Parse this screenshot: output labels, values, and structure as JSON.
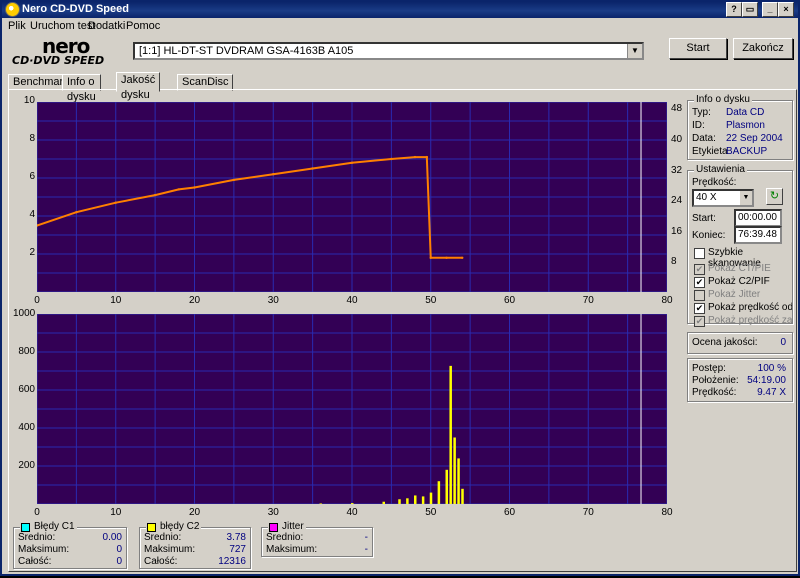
{
  "window": {
    "title": "Nero CD-DVD Speed"
  },
  "menu": [
    "Plik",
    "Uruchom test",
    "Dodatki",
    "Pomoc"
  ],
  "logo": {
    "top": "nero",
    "bottom": "CD·DVD SPEED"
  },
  "drive": {
    "selected": "[1:1]  HL-DT-ST DVDRAM GSA-4163B A105"
  },
  "buttons": {
    "start": "Start",
    "close": "Zakończ"
  },
  "tabs": [
    "Benchmark",
    "Info o dysku",
    "Jakość dysku",
    "ScanDisc"
  ],
  "disc_info": {
    "title": "Info o dysku",
    "type_label": "Typ:",
    "type": "Data CD",
    "id_label": "ID:",
    "id": "Plasmon",
    "date_label": "Data:",
    "date": "22 Sep 2004",
    "label_label": "Etykieta",
    "label": "BACKUP"
  },
  "settings": {
    "title": "Ustawienia",
    "speed_label": "Prędkość:",
    "speed": "40 X",
    "start_label": "Start:",
    "start": "00:00.00",
    "end_label": "Koniec:",
    "end": "76:39.48",
    "quick_scan": "Szybkie skanowanie",
    "opt_ctpie": "Pokaż CT/PIE",
    "opt_c2pif": "Pokaż C2/PIF",
    "opt_jitter": "Pokaż Jitter",
    "opt_read": "Pokaż prędkość odczytu",
    "opt_write": "Pokaż prędkość zapisu"
  },
  "quality": {
    "label": "Ocena jakości:",
    "value": "0"
  },
  "progress": {
    "progress_label": "Postęp:",
    "progress": "100 %",
    "position_label": "Położenie:",
    "position": "54:19.00",
    "speed_label": "Prędkość:",
    "speed": "9.47 X"
  },
  "stats": {
    "c1": {
      "title": "Błędy C1",
      "avg_label": "Średnio:",
      "avg": "0.00",
      "max_label": "Maksimum:",
      "max": "0",
      "total_label": "Całość:",
      "total": "0",
      "color": "#00ffff"
    },
    "c2": {
      "title": "błędy C2",
      "avg_label": "Średnio:",
      "avg": "3.78",
      "max_label": "Maksimum:",
      "max": "727",
      "total_label": "Całość:",
      "total": "12316",
      "color": "#ffff00"
    },
    "jitter": {
      "title": "Jitter",
      "avg_label": "Średnio:",
      "avg": "-",
      "max_label": "Maksimum:",
      "max": "-",
      "color": "#ff00ff"
    }
  },
  "chart_data": [
    {
      "type": "line",
      "name": "read-speed",
      "x_ticks": [
        "0",
        "10",
        "20",
        "30",
        "40",
        "50",
        "60",
        "70",
        "80"
      ],
      "y_ticks_left": [
        "10",
        "8",
        "6",
        "4",
        "2"
      ],
      "y_ticks_right": [
        "48",
        "40",
        "32",
        "24",
        "16",
        "8"
      ],
      "xlim": [
        0,
        80
      ],
      "ylim": [
        0,
        10
      ],
      "ylim_right": [
        0,
        48
      ],
      "series": [
        {
          "color": "#ff8000",
          "x": [
            0,
            5,
            10,
            15,
            18,
            20,
            25,
            30,
            35,
            40,
            45,
            48,
            49.5,
            50,
            52,
            54
          ],
          "y": [
            3.5,
            4.2,
            4.7,
            5.1,
            5.4,
            5.5,
            5.9,
            6.2,
            6.5,
            6.8,
            7.0,
            7.1,
            7.1,
            1.8,
            1.8,
            1.8
          ]
        }
      ],
      "marker_x": 76.7
    },
    {
      "type": "bar",
      "name": "c2-errors",
      "x_ticks": [
        "0",
        "10",
        "20",
        "30",
        "40",
        "50",
        "60",
        "70",
        "80"
      ],
      "y_ticks_left": [
        "1000",
        "800",
        "600",
        "400",
        "200"
      ],
      "xlim": [
        0,
        80
      ],
      "ylim": [
        0,
        1000
      ],
      "series": [
        {
          "color": "#ffff00",
          "x": [
            36,
            40,
            44,
            46,
            47,
            48,
            49,
            50,
            51,
            52,
            52.5,
            53,
            53.5,
            54
          ],
          "y": [
            3,
            5,
            12,
            25,
            30,
            45,
            40,
            60,
            120,
            180,
            727,
            350,
            240,
            80
          ]
        }
      ],
      "marker_x": 76.7
    }
  ]
}
